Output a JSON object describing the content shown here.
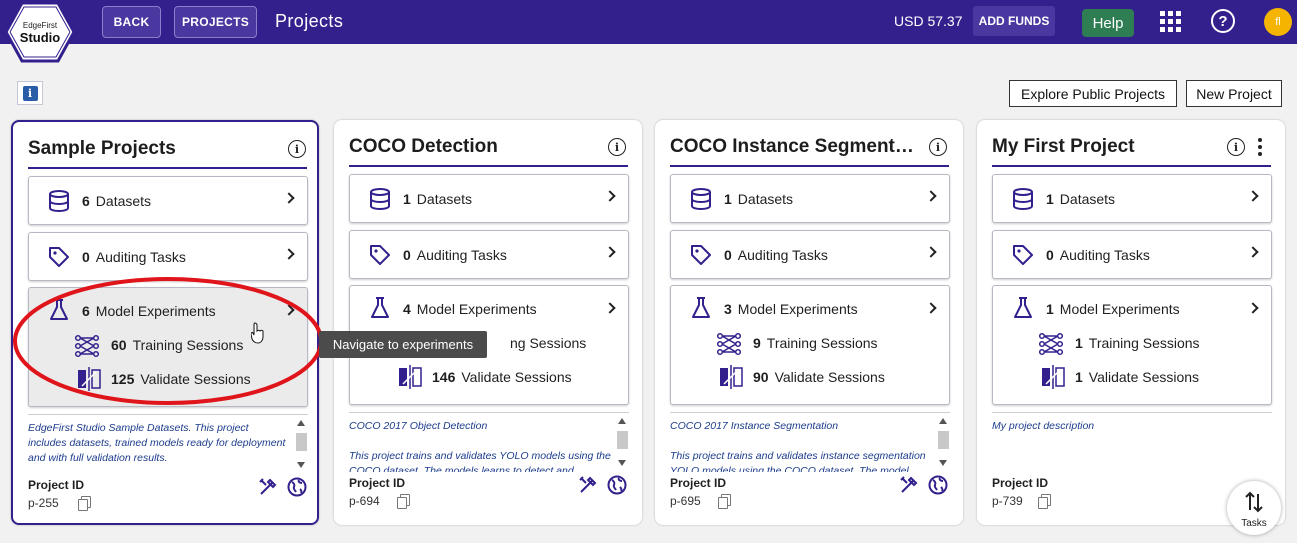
{
  "header": {
    "logo_top": "EdgeFirst",
    "logo_bottom": "Studio",
    "back_label": "BACK",
    "projects_label": "PROJECTS",
    "title": "Projects",
    "balance": "USD 57.37",
    "add_funds_label": "ADD FUNDS",
    "help_label": "Help",
    "help_icon": "?",
    "avatar_initial": "fl"
  },
  "toolbar": {
    "info_icon": "i",
    "explore_label": "Explore Public Projects",
    "new_project_label": "New Project"
  },
  "cards": [
    {
      "title": "Sample Projects",
      "datasets_count": "6",
      "datasets_label": "Datasets",
      "auditing_count": "0",
      "auditing_label": "Auditing Tasks",
      "experiments_count": "6",
      "experiments_label": "Model Experiments",
      "training_count": "60",
      "training_label": "Training Sessions",
      "validate_count": "125",
      "validate_label": "Validate Sessions",
      "description_1": "EdgeFirst Studio Sample Datasets.  This project includes datasets, trained models ready for deployment and with full validation results.",
      "description_2": "",
      "project_id_label": "Project ID",
      "project_id": "p-255"
    },
    {
      "title": "COCO Detection",
      "datasets_count": "1",
      "datasets_label": "Datasets",
      "auditing_count": "0",
      "auditing_label": "Auditing Tasks",
      "experiments_count": "4",
      "experiments_label": "Model Experiments",
      "training_count": "",
      "training_label": "ng Sessions",
      "validate_count": "146",
      "validate_label": "Validate Sessions",
      "description_1": "COCO 2017 Object Detection",
      "description_2": "This project trains and validates YOLO models using the COCO dataset. The models learns to detect and",
      "project_id_label": "Project ID",
      "project_id": "p-694"
    },
    {
      "title": "COCO Instance Segmentati...",
      "datasets_count": "1",
      "datasets_label": "Datasets",
      "auditing_count": "0",
      "auditing_label": "Auditing Tasks",
      "experiments_count": "3",
      "experiments_label": "Model Experiments",
      "training_count": "9",
      "training_label": "Training Sessions",
      "validate_count": "90",
      "validate_label": "Validate Sessions",
      "description_1": "COCO 2017 Instance Segmentation",
      "description_2": "This project trains and validates instance segmentation YOLO models using the COCO dataset. The model",
      "project_id_label": "Project ID",
      "project_id": "p-695"
    },
    {
      "title": "My First Project",
      "datasets_count": "1",
      "datasets_label": "Datasets",
      "auditing_count": "0",
      "auditing_label": "Auditing Tasks",
      "experiments_count": "1",
      "experiments_label": "Model Experiments",
      "training_count": "1",
      "training_label": "Training Sessions",
      "validate_count": "1",
      "validate_label": "Validate Sessions",
      "description_1": "My project description",
      "description_2": "",
      "project_id_label": "Project ID",
      "project_id": "p-739"
    }
  ],
  "tooltip": "Navigate to experiments",
  "tasks_label": "Tasks",
  "colors": {
    "brand": "#34208d",
    "help": "#2f7d52",
    "avatar": "#f5b400",
    "highlight": "#e0151b"
  }
}
